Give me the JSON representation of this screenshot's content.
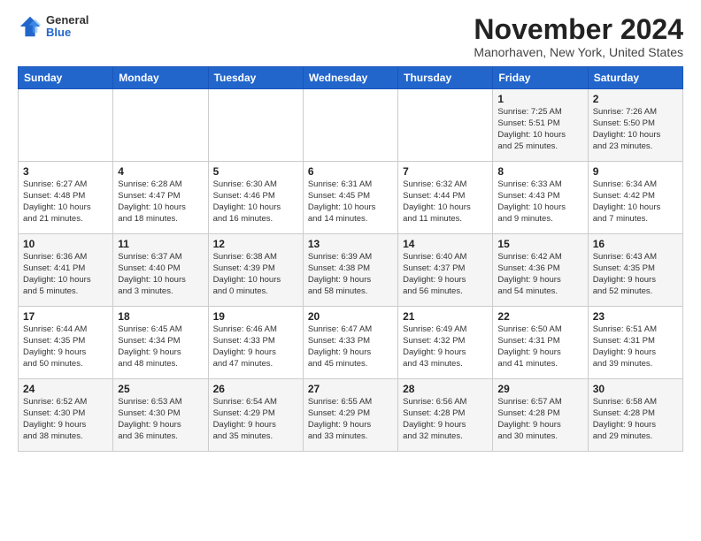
{
  "header": {
    "logo_general": "General",
    "logo_blue": "Blue",
    "month_title": "November 2024",
    "location": "Manorhaven, New York, United States"
  },
  "days_of_week": [
    "Sunday",
    "Monday",
    "Tuesday",
    "Wednesday",
    "Thursday",
    "Friday",
    "Saturday"
  ],
  "weeks": [
    [
      {
        "day": "",
        "info": ""
      },
      {
        "day": "",
        "info": ""
      },
      {
        "day": "",
        "info": ""
      },
      {
        "day": "",
        "info": ""
      },
      {
        "day": "",
        "info": ""
      },
      {
        "day": "1",
        "info": "Sunrise: 7:25 AM\nSunset: 5:51 PM\nDaylight: 10 hours\nand 25 minutes."
      },
      {
        "day": "2",
        "info": "Sunrise: 7:26 AM\nSunset: 5:50 PM\nDaylight: 10 hours\nand 23 minutes."
      }
    ],
    [
      {
        "day": "3",
        "info": "Sunrise: 6:27 AM\nSunset: 4:48 PM\nDaylight: 10 hours\nand 21 minutes."
      },
      {
        "day": "4",
        "info": "Sunrise: 6:28 AM\nSunset: 4:47 PM\nDaylight: 10 hours\nand 18 minutes."
      },
      {
        "day": "5",
        "info": "Sunrise: 6:30 AM\nSunset: 4:46 PM\nDaylight: 10 hours\nand 16 minutes."
      },
      {
        "day": "6",
        "info": "Sunrise: 6:31 AM\nSunset: 4:45 PM\nDaylight: 10 hours\nand 14 minutes."
      },
      {
        "day": "7",
        "info": "Sunrise: 6:32 AM\nSunset: 4:44 PM\nDaylight: 10 hours\nand 11 minutes."
      },
      {
        "day": "8",
        "info": "Sunrise: 6:33 AM\nSunset: 4:43 PM\nDaylight: 10 hours\nand 9 minutes."
      },
      {
        "day": "9",
        "info": "Sunrise: 6:34 AM\nSunset: 4:42 PM\nDaylight: 10 hours\nand 7 minutes."
      }
    ],
    [
      {
        "day": "10",
        "info": "Sunrise: 6:36 AM\nSunset: 4:41 PM\nDaylight: 10 hours\nand 5 minutes."
      },
      {
        "day": "11",
        "info": "Sunrise: 6:37 AM\nSunset: 4:40 PM\nDaylight: 10 hours\nand 3 minutes."
      },
      {
        "day": "12",
        "info": "Sunrise: 6:38 AM\nSunset: 4:39 PM\nDaylight: 10 hours\nand 0 minutes."
      },
      {
        "day": "13",
        "info": "Sunrise: 6:39 AM\nSunset: 4:38 PM\nDaylight: 9 hours\nand 58 minutes."
      },
      {
        "day": "14",
        "info": "Sunrise: 6:40 AM\nSunset: 4:37 PM\nDaylight: 9 hours\nand 56 minutes."
      },
      {
        "day": "15",
        "info": "Sunrise: 6:42 AM\nSunset: 4:36 PM\nDaylight: 9 hours\nand 54 minutes."
      },
      {
        "day": "16",
        "info": "Sunrise: 6:43 AM\nSunset: 4:35 PM\nDaylight: 9 hours\nand 52 minutes."
      }
    ],
    [
      {
        "day": "17",
        "info": "Sunrise: 6:44 AM\nSunset: 4:35 PM\nDaylight: 9 hours\nand 50 minutes."
      },
      {
        "day": "18",
        "info": "Sunrise: 6:45 AM\nSunset: 4:34 PM\nDaylight: 9 hours\nand 48 minutes."
      },
      {
        "day": "19",
        "info": "Sunrise: 6:46 AM\nSunset: 4:33 PM\nDaylight: 9 hours\nand 47 minutes."
      },
      {
        "day": "20",
        "info": "Sunrise: 6:47 AM\nSunset: 4:33 PM\nDaylight: 9 hours\nand 45 minutes."
      },
      {
        "day": "21",
        "info": "Sunrise: 6:49 AM\nSunset: 4:32 PM\nDaylight: 9 hours\nand 43 minutes."
      },
      {
        "day": "22",
        "info": "Sunrise: 6:50 AM\nSunset: 4:31 PM\nDaylight: 9 hours\nand 41 minutes."
      },
      {
        "day": "23",
        "info": "Sunrise: 6:51 AM\nSunset: 4:31 PM\nDaylight: 9 hours\nand 39 minutes."
      }
    ],
    [
      {
        "day": "24",
        "info": "Sunrise: 6:52 AM\nSunset: 4:30 PM\nDaylight: 9 hours\nand 38 minutes."
      },
      {
        "day": "25",
        "info": "Sunrise: 6:53 AM\nSunset: 4:30 PM\nDaylight: 9 hours\nand 36 minutes."
      },
      {
        "day": "26",
        "info": "Sunrise: 6:54 AM\nSunset: 4:29 PM\nDaylight: 9 hours\nand 35 minutes."
      },
      {
        "day": "27",
        "info": "Sunrise: 6:55 AM\nSunset: 4:29 PM\nDaylight: 9 hours\nand 33 minutes."
      },
      {
        "day": "28",
        "info": "Sunrise: 6:56 AM\nSunset: 4:28 PM\nDaylight: 9 hours\nand 32 minutes."
      },
      {
        "day": "29",
        "info": "Sunrise: 6:57 AM\nSunset: 4:28 PM\nDaylight: 9 hours\nand 30 minutes."
      },
      {
        "day": "30",
        "info": "Sunrise: 6:58 AM\nSunset: 4:28 PM\nDaylight: 9 hours\nand 29 minutes."
      }
    ]
  ]
}
